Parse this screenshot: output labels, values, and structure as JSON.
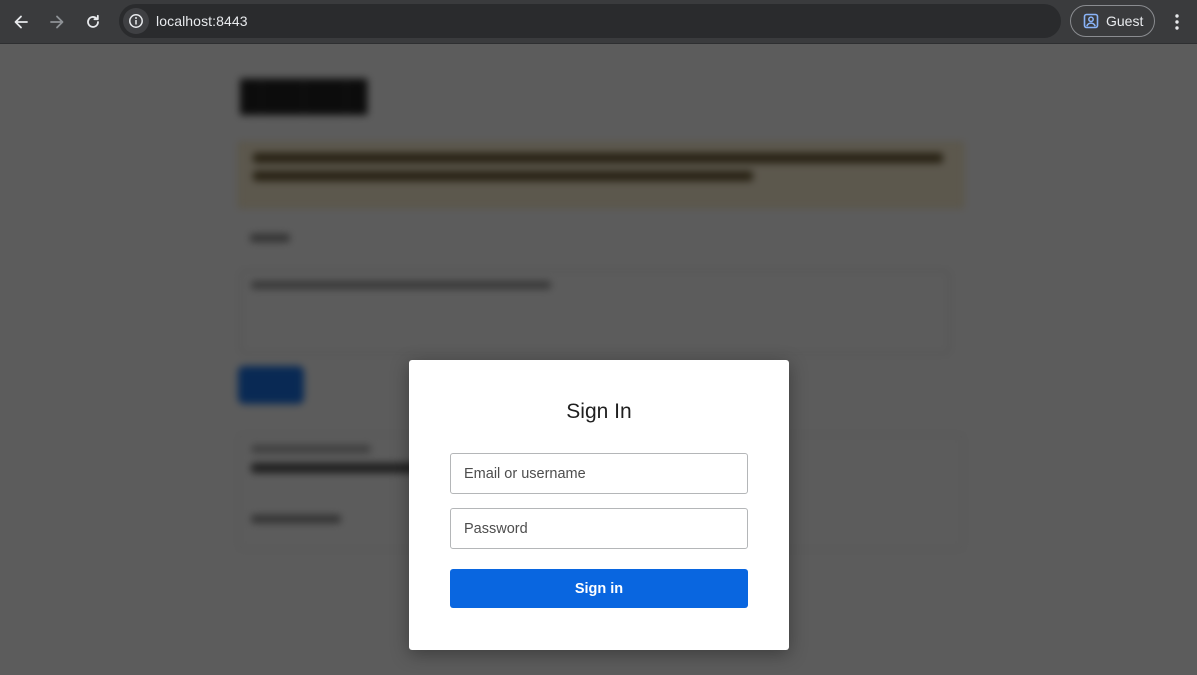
{
  "browser": {
    "url": "localhost:8443",
    "profile_label": "Guest",
    "icons": {
      "back": "back-arrow-icon",
      "forward": "forward-arrow-icon",
      "reload": "reload-icon",
      "site_info": "info-icon",
      "profile": "guest-profile-icon",
      "menu": "kebab-menu-icon"
    }
  },
  "modal": {
    "title": "Sign In",
    "email_placeholder": "Email or username",
    "password_placeholder": "Password",
    "submit_label": "Sign in"
  },
  "colors": {
    "primary_button": "#0966e0",
    "overlay": "rgba(0,0,0,0.64)",
    "chrome_bg": "#3a3b3d"
  }
}
